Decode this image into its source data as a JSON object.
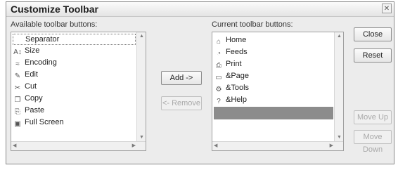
{
  "dialog": {
    "title": "Customize Toolbar",
    "close_glyph": "✕"
  },
  "available": {
    "label": "Available toolbar buttons:",
    "items": [
      {
        "icon": "separator-icon",
        "glyph": "",
        "label": "Separator"
      },
      {
        "icon": "size-icon",
        "glyph": "A↕",
        "label": "Size"
      },
      {
        "icon": "encoding-icon",
        "glyph": "≈",
        "label": "Encoding"
      },
      {
        "icon": "edit-icon",
        "glyph": "✎",
        "label": "Edit"
      },
      {
        "icon": "cut-icon",
        "glyph": "✂",
        "label": "Cut"
      },
      {
        "icon": "copy-icon",
        "glyph": "❐",
        "label": "Copy"
      },
      {
        "icon": "paste-icon",
        "glyph": "⎘",
        "label": "Paste"
      },
      {
        "icon": "full-screen-icon",
        "glyph": "▣",
        "label": "Full Screen"
      }
    ]
  },
  "current": {
    "label": "Current toolbar buttons:",
    "items": [
      {
        "icon": "home-icon",
        "glyph": "⌂",
        "label": "Home"
      },
      {
        "icon": "feeds-icon",
        "glyph": "◔",
        "label": "Feeds"
      },
      {
        "icon": "print-icon",
        "glyph": "⎙",
        "label": "Print"
      },
      {
        "icon": "page-icon",
        "glyph": "▭",
        "label": "&Page"
      },
      {
        "icon": "tools-icon",
        "glyph": "⚙",
        "label": "&Tools"
      },
      {
        "icon": "help-icon",
        "glyph": "?",
        "label": "&Help"
      }
    ]
  },
  "buttons": {
    "add": "Add ->",
    "remove": "<- Remove",
    "close": "Close",
    "reset": "Reset",
    "move_up": "Move Up",
    "move_down": "Move Down"
  }
}
